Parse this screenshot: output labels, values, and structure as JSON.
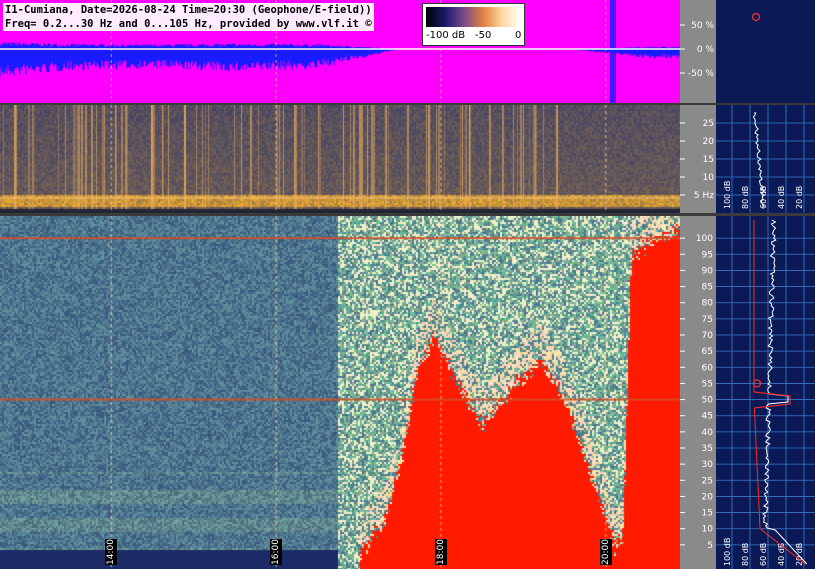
{
  "header": {
    "line1": "I1-Cumiana, Date=2026-08-24 Time=20:30 (Geophone/E-field))",
    "line2": "Freq= 0.2...30 Hz and 0...105 Hz, provided by www.vlf.it ©"
  },
  "colorbar": {
    "labels": [
      "-100 dB",
      "-50",
      "0"
    ]
  },
  "colors": {
    "waveform_bg": "#ff00ff",
    "waveform_fg": "#1a1aff",
    "side_bg": "#0b1a57",
    "axis_bg": "#8a8a8a",
    "red_fill": "#ff1a00"
  },
  "chart_data": [
    {
      "type": "area",
      "panel": "waveform amplitude",
      "ylim": [
        -100,
        100
      ],
      "yticks": [
        "50 %",
        "0 %",
        "-50 %"
      ],
      "ytick_values": [
        50,
        0,
        -50
      ],
      "xlim": [
        12.65,
        20.9
      ],
      "x": [
        12.7,
        13.5,
        14.5,
        15.5,
        16.5,
        17.5,
        18.5,
        19.5,
        20.1,
        20.5
      ],
      "values": [
        60,
        45,
        40,
        48,
        42,
        0,
        0,
        0,
        10,
        20
      ]
    },
    {
      "type": "heatmap",
      "panel": "low-frequency spectrogram",
      "ylim": [
        0,
        30
      ],
      "yticks": [
        "25",
        "20",
        "15",
        "10",
        "5 Hz"
      ],
      "ytick_values": [
        25,
        20,
        15,
        10,
        5
      ],
      "side_scale_labels": [
        "100 dB",
        "80 dB",
        "60 dB",
        "40 dB",
        "20 dB"
      ]
    },
    {
      "type": "heatmap",
      "panel": "high-frequency spectrogram",
      "ylim": [
        0,
        105
      ],
      "yticks": [
        "100",
        "95",
        "90",
        "85",
        "80",
        "75",
        "70",
        "65",
        "60",
        "55",
        "50",
        "45",
        "40",
        "35",
        "30",
        "25",
        "20",
        "15",
        "10",
        "5"
      ],
      "ytick_values": [
        100,
        95,
        90,
        85,
        80,
        75,
        70,
        65,
        60,
        55,
        50,
        45,
        40,
        35,
        30,
        25,
        20,
        15,
        10,
        5
      ],
      "xlim": [
        12.65,
        20.9
      ],
      "time_labels": [
        "14:00",
        "16:00",
        "18:00",
        "20:00"
      ],
      "time_values": [
        14,
        16,
        18,
        20
      ],
      "red_region_top_hz": [
        [
          17.0,
          2
        ],
        [
          17.3,
          12
        ],
        [
          17.5,
          30
        ],
        [
          17.7,
          58
        ],
        [
          17.9,
          70
        ],
        [
          18.2,
          55
        ],
        [
          18.5,
          42
        ],
        [
          18.9,
          55
        ],
        [
          19.2,
          62
        ],
        [
          19.5,
          50
        ],
        [
          19.9,
          20
        ],
        [
          20.1,
          5
        ],
        [
          20.2,
          8
        ],
        [
          20.3,
          95
        ],
        [
          20.6,
          100
        ],
        [
          20.9,
          102
        ]
      ],
      "side_scale_labels": [
        "100 dB",
        "80 dB",
        "60 dB",
        "40 dB",
        "20 dB"
      ]
    }
  ]
}
